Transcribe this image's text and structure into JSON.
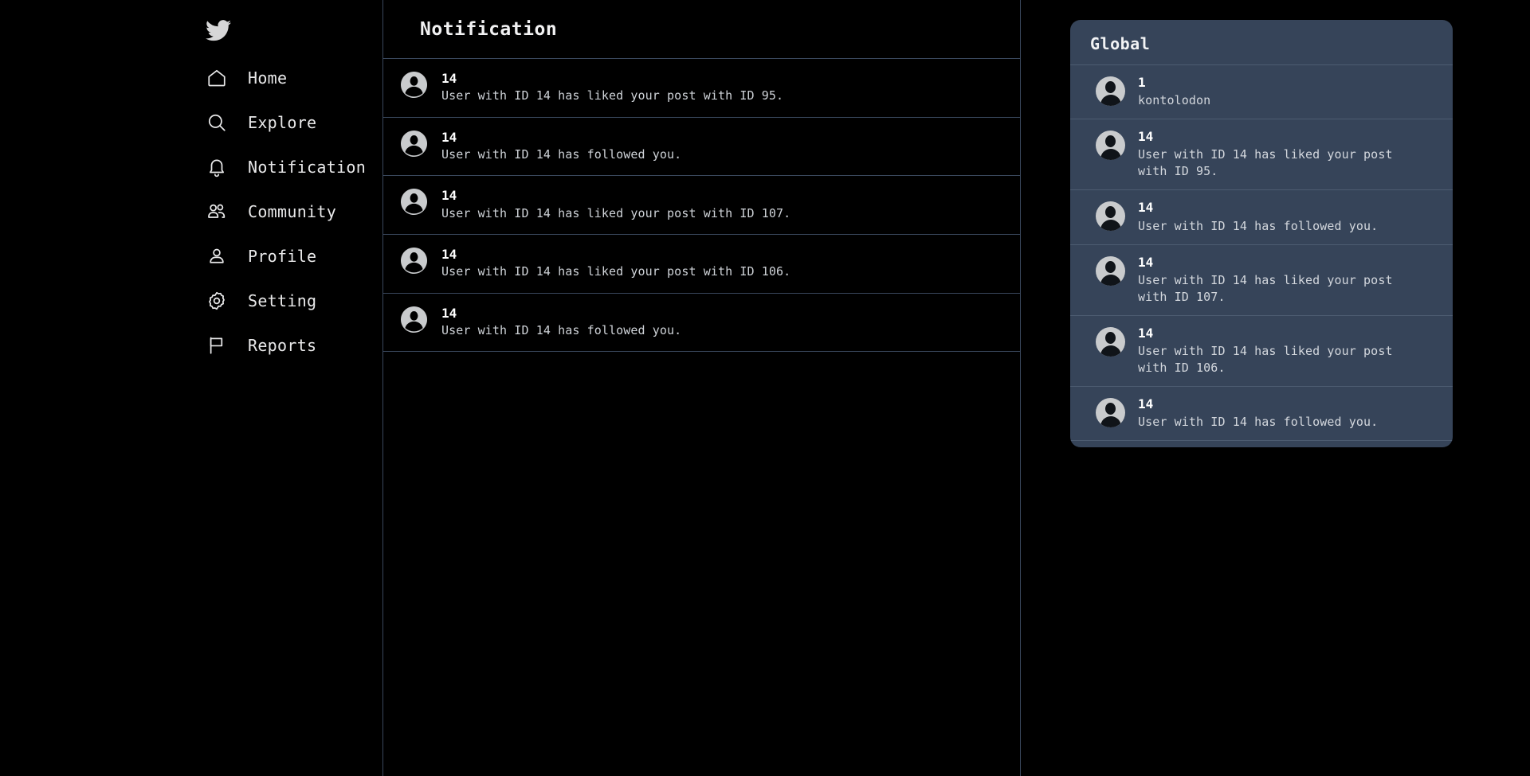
{
  "brand": {
    "icon": "twitter-bird-icon"
  },
  "sidebar": {
    "items": [
      {
        "label": "Home",
        "icon": "home-icon"
      },
      {
        "label": "Explore",
        "icon": "search-icon"
      },
      {
        "label": "Notification",
        "icon": "bell-icon"
      },
      {
        "label": "Community",
        "icon": "people-icon"
      },
      {
        "label": "Profile",
        "icon": "person-icon"
      },
      {
        "label": "Setting",
        "icon": "gear-icon"
      },
      {
        "label": "Reports",
        "icon": "flag-icon"
      }
    ]
  },
  "main": {
    "title": "Notification",
    "notifications": [
      {
        "user": "14",
        "message": "User with ID 14 has liked your post with ID 95."
      },
      {
        "user": "14",
        "message": "User with ID 14 has followed you."
      },
      {
        "user": "14",
        "message": "User with ID 14 has liked your post with ID 107."
      },
      {
        "user": "14",
        "message": "User with ID 14 has liked your post with ID 106."
      },
      {
        "user": "14",
        "message": "User with ID 14 has followed you."
      }
    ]
  },
  "global_panel": {
    "title": "Global",
    "items": [
      {
        "user": "1",
        "message": "kontolodon"
      },
      {
        "user": "14",
        "message": "User with ID 14 has liked your post with ID 95."
      },
      {
        "user": "14",
        "message": "User with ID 14 has followed you."
      },
      {
        "user": "14",
        "message": "User with ID 14 has liked your post with ID 107."
      },
      {
        "user": "14",
        "message": "User with ID 14 has liked your post with ID 106."
      },
      {
        "user": "14",
        "message": "User with ID 14 has followed you."
      }
    ]
  },
  "colors": {
    "background": "#000000",
    "panel": "#364459",
    "border": "#39475c",
    "panel_border": "#4d5c71",
    "text_primary": "#ffffff",
    "text_secondary": "#cfd3d8"
  }
}
